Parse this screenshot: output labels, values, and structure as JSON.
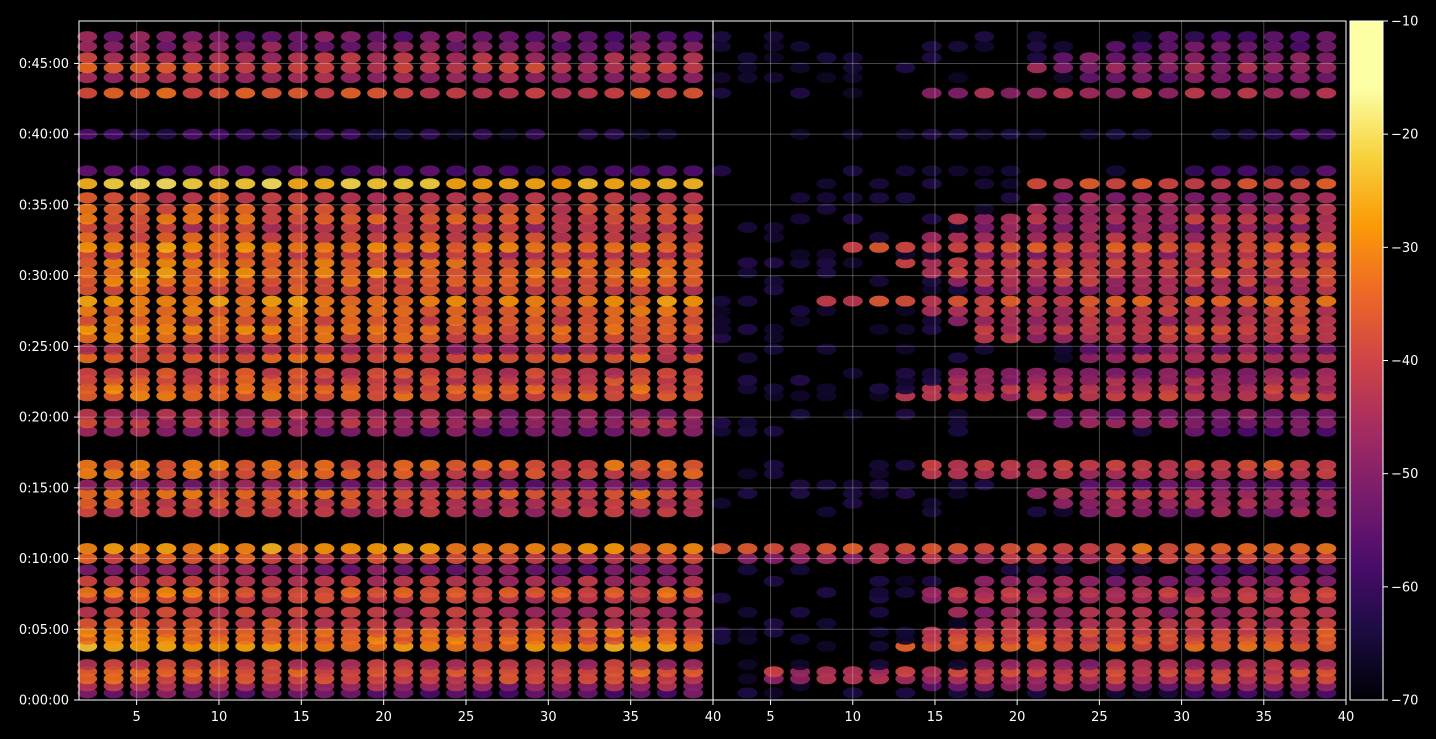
{
  "chart_data": {
    "type": "heatmap",
    "panels": [
      {
        "name": "",
        "x_range": [
          1.5,
          40
        ]
      },
      {
        "name": "",
        "x_range": [
          1.5,
          40
        ]
      }
    ],
    "x_tick_labels": [
      "5",
      "10",
      "15",
      "20",
      "25",
      "30",
      "35",
      "40"
    ],
    "x_tick_values": [
      5,
      10,
      15,
      20,
      25,
      30,
      35,
      40
    ],
    "y_tick_labels": [
      "0:00:00",
      "0:05:00",
      "0:10:00",
      "0:15:00",
      "0:20:00",
      "0:25:00",
      "0:30:00",
      "0:35:00",
      "0:40:00",
      "0:45:00"
    ],
    "y_tick_values_minutes": [
      0,
      5,
      10,
      15,
      20,
      25,
      30,
      35,
      40,
      45
    ],
    "y_range_minutes": [
      0,
      48
    ],
    "colorbar": {
      "colormap": "inferno",
      "range": [
        -70,
        -10
      ],
      "tick_labels": [
        "−10",
        "−20",
        "−30",
        "−40",
        "−50",
        "−60",
        "−70"
      ],
      "tick_values": [
        -10,
        -20,
        -30,
        -40,
        -50,
        -60,
        -70
      ]
    },
    "rows_minutes": [
      0.5,
      1.0,
      1.5,
      2.0,
      2.5,
      3.8,
      4.3,
      4.8,
      5.4,
      6.2,
      7.2,
      7.6,
      8.4,
      9.2,
      10.0,
      10.7,
      13.3,
      13.9,
      14.6,
      15.2,
      16.0,
      16.6,
      19.0,
      19.6,
      20.2,
      21.5,
      22.0,
      22.6,
      23.1,
      24.2,
      24.8,
      25.6,
      26.2,
      26.8,
      27.5,
      28.2,
      29.0,
      29.6,
      30.2,
      30.9,
      31.5,
      32.0,
      32.7,
      33.4,
      34.0,
      34.7,
      35.5,
      36.5,
      37.4,
      40.0,
      42.9,
      44.0,
      44.7,
      45.4,
      46.2,
      46.9
    ],
    "left_panel_levels_dB": [
      -52,
      -44,
      -36,
      -34,
      -40,
      -27,
      -30,
      -33,
      -37,
      -40,
      -38,
      -33,
      -40,
      -48,
      -36,
      -27,
      -40,
      -38,
      -33,
      -48,
      -34,
      -33,
      -48,
      -42,
      -44,
      -32,
      -33,
      -36,
      -37,
      -34,
      -42,
      -33,
      -30,
      -34,
      -32,
      -28,
      -36,
      -33,
      -30,
      -32,
      -38,
      -29,
      -36,
      -40,
      -34,
      -36,
      -38,
      -22,
      -55,
      -60,
      -36,
      -44,
      -37,
      -42,
      -48,
      -50
    ],
    "right_panel_levels_dB": [
      -58,
      -52,
      -46,
      -44,
      -48,
      -38,
      -40,
      -42,
      -45,
      -48,
      -46,
      -44,
      -50,
      -58,
      -47,
      -40,
      -50,
      -48,
      -45,
      -55,
      -44,
      -42,
      -56,
      -50,
      -52,
      -44,
      -46,
      -48,
      -50,
      -46,
      -52,
      -45,
      -42,
      -46,
      -44,
      -40,
      -48,
      -45,
      -42,
      -44,
      -48,
      -40,
      -46,
      -50,
      -46,
      -48,
      -50,
      -40,
      -60,
      -62,
      -48,
      -54,
      -49,
      -52,
      -56,
      -58
    ],
    "right_panel_onset_x": [
      30,
      14,
      5,
      5,
      18,
      12,
      14,
      14,
      18,
      16,
      14,
      14,
      18,
      30,
      3,
      1,
      24,
      22,
      20,
      24,
      14,
      14,
      30,
      22,
      20,
      12,
      14,
      16,
      16,
      24,
      24,
      18,
      18,
      16,
      14,
      8,
      18,
      16,
      14,
      12,
      18,
      10,
      14,
      18,
      16,
      20,
      22,
      20,
      30,
      32,
      14,
      24,
      20,
      22,
      26,
      28
    ],
    "grid": true,
    "title": "",
    "xlabel": "",
    "ylabel": ""
  }
}
